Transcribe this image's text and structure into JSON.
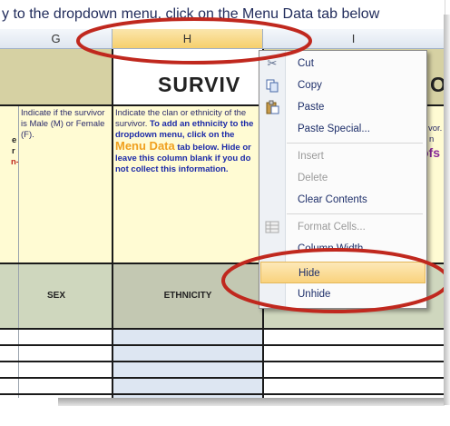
{
  "banner": {
    "text": "y to the dropdown menu, click on the Menu Data tab below"
  },
  "columns": {
    "g": "G",
    "h": "H",
    "i": "I"
  },
  "title_fragment_left": "SURVIV",
  "title_fragment_right": "O",
  "header_row": {
    "partial_left_lines": [
      "e",
      "r",
      "n-"
    ],
    "sex_description": "Indicate if the survivor is Male (M) or Female (F).",
    "ethnicity_description_1": "Indicate the clan or ethnicity of the survivor.",
    "ethnicity_description_2": "To add an ethnicity to the dropdown menu, click on the",
    "ethnicity_menu_data": "Menu Data",
    "ethnicity_description_3": "tab below. Hide or leave this column blank if you do not collect this information.",
    "right_fragment_1": "vor.",
    "right_fragment_2": "n",
    "right_fragment_3": "ofs"
  },
  "field_headers": {
    "sex": "SEX",
    "ethnicity": "ETHNICITY"
  },
  "context_menu": {
    "items": [
      {
        "label": "Cut",
        "icon": "scissors-icon",
        "enabled": true
      },
      {
        "label": "Copy",
        "icon": "copy-icon",
        "enabled": true
      },
      {
        "label": "Paste",
        "icon": "paste-icon",
        "enabled": true
      },
      {
        "label": "Paste Special...",
        "icon": "",
        "enabled": true
      },
      {
        "label": "Insert",
        "icon": "",
        "enabled": false
      },
      {
        "label": "Delete",
        "icon": "",
        "enabled": false
      },
      {
        "label": "Clear Contents",
        "icon": "",
        "enabled": true
      },
      {
        "label": "Format Cells...",
        "icon": "format-cells-icon",
        "enabled": false
      },
      {
        "label": "Column Width...",
        "icon": "",
        "enabled": true
      },
      {
        "label": "Hide",
        "icon": "",
        "enabled": true,
        "highlighted": true
      },
      {
        "label": "Unhide",
        "icon": "",
        "enabled": true
      }
    ]
  },
  "colors": {
    "header_fill": "#d9d2a8",
    "selected_column": "#dde6f2",
    "highlight": "#f9d27d",
    "annotation_red": "#c0281e"
  }
}
